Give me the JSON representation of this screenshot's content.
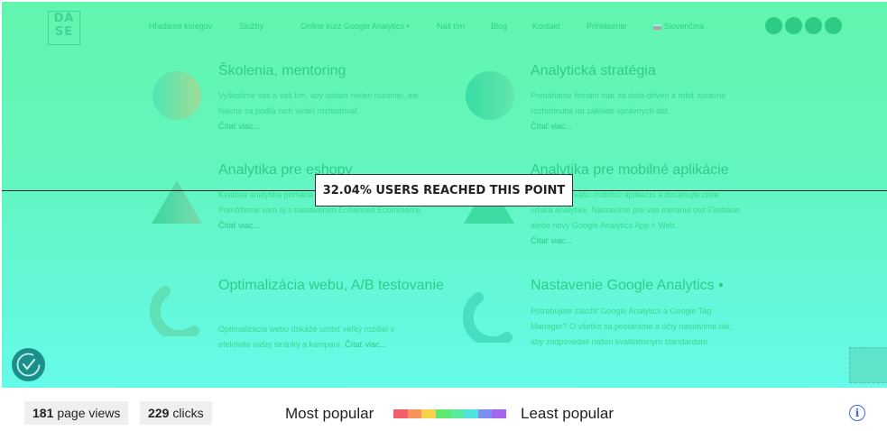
{
  "site": {
    "logo_text_1": "DA",
    "logo_text_2": "SE",
    "nav": [
      "Hľadáme kolegov",
      "Služby",
      "Online kurz Google Analytics •",
      "Náš tím",
      "Blog",
      "Kontakt",
      "Prihlásenie",
      "Slovenčina"
    ]
  },
  "cards": [
    {
      "title": "Školenia, mentoring",
      "text": "Vyškolíme vás a váš tím, aby dátam nielen rozumel, ale hlavne sa podľa nich vedel rozhodovať.",
      "more": "Čítať viac..."
    },
    {
      "title": "Analytická stratégia",
      "text": "Pomáhame firmám stať sa data-driven a robiť správne rozhodnutia na základe správnych dát.",
      "more": "Čítať viac..."
    },
    {
      "title": "Analytika pre eshopy",
      "text": "Kvalitná analytika pomáha eshopom rásť a viac zarábať. Pomôžeme vám aj s nastavením Enhanced Ecommerce.",
      "more": "Čítať viac..."
    },
    {
      "title": "Analytika pre mobilné aplikácie",
      "text": "Pomôžeme vašu mobilnú aplikáciu a dosahujte ciele vďaka analytike. Nastavíme pre vás meranie cez Firebase alebo nový Google Analytics App + Web.",
      "more": "Čítať viac..."
    },
    {
      "title": "Optimalizácia webu, A/B testovanie",
      "text": "Optimalizácia webu dokáže urobiť veľký rozdiel v efektivite vašej stránky a kampaní.",
      "more": "Čítať viac..."
    },
    {
      "title": "Nastavenie Google Analytics •",
      "text": "Potrebujete založiť Google Analytics a Google Tag Manager? O všetko sa postaráme a účty nastavíme tak, aby zodpovedali našim kvalitatívnym štandardom.",
      "more": ""
    }
  ],
  "scroll_marker": {
    "label": "32.04% USERS REACHED THIS POINT"
  },
  "stats": {
    "page_views_value": "181",
    "page_views_label": "page views",
    "clicks_value": "229",
    "clicks_label": "clicks"
  },
  "legend": {
    "most": "Most popular",
    "least": "Least popular",
    "colors": [
      "#f25f6a",
      "#f7925c",
      "#f5d24a",
      "#5ee86f",
      "#58ea9c",
      "#4fe3e0",
      "#7b8ff0",
      "#a566ef"
    ]
  },
  "info_glyph": "i"
}
